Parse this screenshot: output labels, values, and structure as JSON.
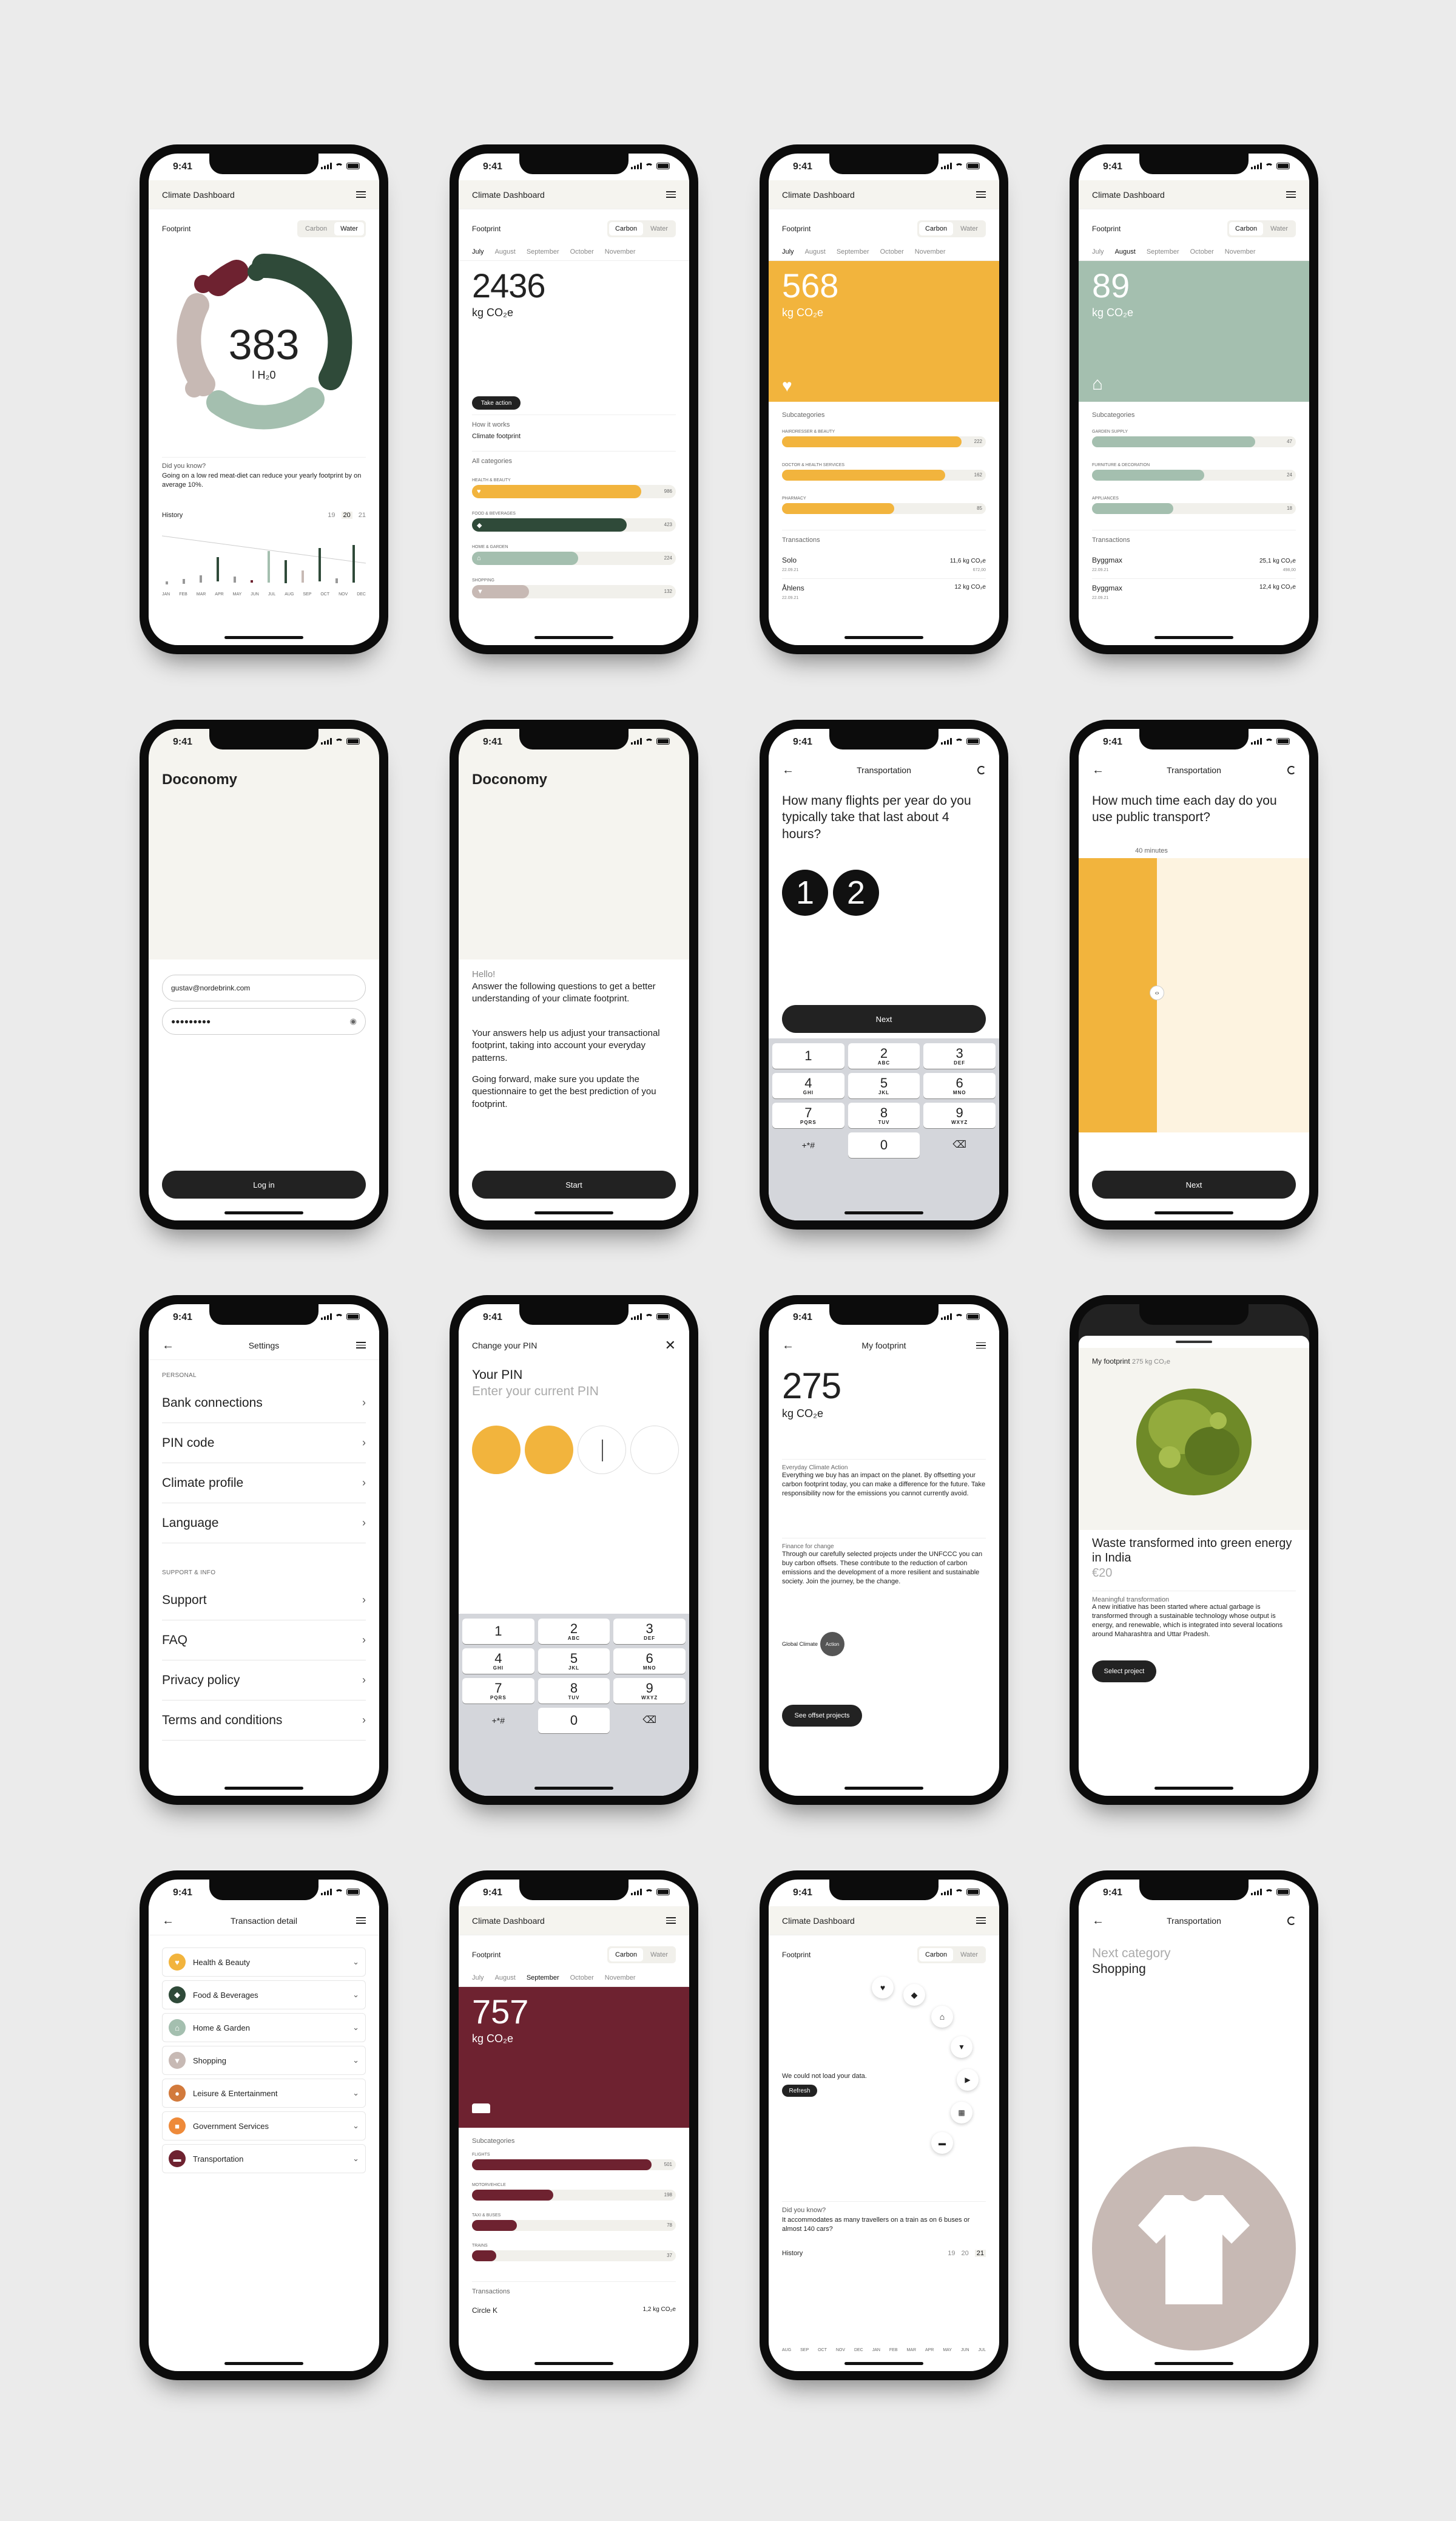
{
  "status_time": "9:41",
  "colors": {
    "green": "#2f4a39",
    "sage": "#a4bfaf",
    "mustard": "#f2b43d",
    "wine": "#6e2230",
    "rose": "#c7b9b4",
    "cream": "#f5f4ef",
    "dark": "#222222"
  },
  "dash": {
    "title": "Climate Dashboard",
    "footprint": "Footprint",
    "carbon": "Carbon",
    "water": "Water"
  },
  "months5": [
    "July",
    "August",
    "September",
    "October",
    "November"
  ],
  "s1": {
    "value": "383",
    "unit": "l H₂0",
    "dyk_title": "Did you know?",
    "dyk_text": "Going on a low red meat-diet can reduce your yearly footprint by on average 10%.",
    "history": "History",
    "years": [
      "19",
      "20",
      "21"
    ],
    "hist_months": [
      "JAN",
      "FEB",
      "MAR",
      "APR",
      "MAY",
      "JUN",
      "JUL",
      "AUG",
      "SEP",
      "OCT",
      "NOV",
      "DEC"
    ]
  },
  "s2": {
    "value": "2436",
    "unit": "kg CO₂e",
    "take_action": "Take action",
    "how": "How it works",
    "how_sub": "Climate footprint",
    "all": "All categories",
    "cats": [
      {
        "label": "HEALTH & BEAUTY",
        "value": "986",
        "pct": 0.83
      },
      {
        "label": "FOOD & BEVERAGES",
        "value": "423",
        "pct": 0.76
      },
      {
        "label": "HOME & GARDEN",
        "value": "224",
        "pct": 0.52
      },
      {
        "label": "SHOPPING",
        "value": "132",
        "pct": 0.28
      }
    ]
  },
  "s3": {
    "value": "568",
    "unit": "kg CO₂e",
    "subcats": "Subcategories",
    "items": [
      {
        "label": "HAIRDRESSER & BEAUTY",
        "value": "222",
        "pct": 0.88
      },
      {
        "label": "DOCTOR & HEALTH SERVICES",
        "value": "162",
        "pct": 0.8
      },
      {
        "label": "PHARMACY",
        "value": "85",
        "pct": 0.55
      }
    ],
    "transactions": "Transactions",
    "tx": [
      {
        "name": "Solo",
        "date": "22.09.21",
        "amount": "11,6 kg CO₂e",
        "price": "672,00"
      },
      {
        "name": "Åhlens",
        "date": "22.09.21",
        "amount": "12 kg CO₂e",
        "price": ""
      }
    ]
  },
  "s4": {
    "value": "89",
    "unit": "kg CO₂e",
    "subcats": "Subcategories",
    "items": [
      {
        "label": "GARDEN SUPPLY",
        "value": "47",
        "pct": 0.8
      },
      {
        "label": "FURNITURE & DECORATION",
        "value": "24",
        "pct": 0.55
      },
      {
        "label": "APPLIANCES",
        "value": "18",
        "pct": 0.4
      }
    ],
    "transactions": "Transactions",
    "tx": [
      {
        "name": "Byggmax",
        "date": "22.09.21",
        "amount": "25,1 kg CO₂e",
        "price": "498,00"
      },
      {
        "name": "Byggmax",
        "date": "22.09.21",
        "amount": "12,4 kg CO₂e",
        "price": ""
      }
    ]
  },
  "login": {
    "brand": "Doconomy",
    "email": "gustav@nordebrink.com",
    "password": "●●●●●●●●●",
    "button": "Log in"
  },
  "intro": {
    "brand": "Doconomy",
    "hello": "Hello!",
    "p1": "Answer the following questions to get a better understanding of your climate footprint.",
    "p2": "Your answers help us adjust your transactional footprint, taking into account your everyday patterns.",
    "p3": "Going forward, make sure you update the questionnaire to get the best prediction of you footprint.",
    "button": "Start"
  },
  "flights": {
    "title": "Transportation",
    "question": "How many flights per year do you typically take that last about 4 hours?",
    "digits": [
      "1",
      "2"
    ],
    "next": "Next"
  },
  "keypad": [
    [
      "1",
      ""
    ],
    [
      "2",
      "ABC"
    ],
    [
      "3",
      "DEF"
    ],
    [
      "4",
      "GHI"
    ],
    [
      "5",
      "JKL"
    ],
    [
      "6",
      "MNO"
    ],
    [
      "7",
      "PQRS"
    ],
    [
      "8",
      "TUV"
    ],
    [
      "9",
      "WXYZ"
    ],
    [
      "+*#",
      ""
    ],
    [
      "0",
      ""
    ],
    [
      "⌫",
      ""
    ]
  ],
  "transit": {
    "title": "Transportation",
    "question": "How much time each day do you use public transport?",
    "minutes": "40 minutes",
    "fraction": 0.34,
    "next": "Next"
  },
  "settings": {
    "title": "Settings",
    "personal": "PERSONAL",
    "items1": [
      "Bank connections",
      "PIN code",
      "Climate profile",
      "Language"
    ],
    "support": "SUPPORT & INFO",
    "items2": [
      "Support",
      "FAQ",
      "Privacy policy",
      "Terms and conditions"
    ]
  },
  "pin": {
    "title": "Change your PIN",
    "heading": "Your PIN",
    "sub": "Enter your current PIN"
  },
  "myfp": {
    "title": "My footprint",
    "value": "275",
    "unit": "kg CO₂e",
    "h1": "Everyday Climate Action",
    "p1": "Everything we buy has an impact on the planet. By offsetting your carbon footprint today, you can make a difference for the future. Take responsibility now for the emissions you cannot currently avoid.",
    "h2": "Finance for change",
    "p2": "Through our carefully selected projects under the UNFCCC you can buy carbon offsets. These contribute to the reduction of carbon emissions and the development of a more resilient and sustainable society. Join the journey, be the change.",
    "logo": "Global Climate",
    "logo2": "Action",
    "button": "See offset projects"
  },
  "project": {
    "label": "My footprint",
    "value": "275 kg CO₂e",
    "title": "Waste transformed into green energy in India",
    "price": "€20",
    "sub": "Meaningful transformation",
    "text": "A new initiative has been started where actual garbage is transformed through a sustainable technology whose output is energy, and renewable, which is integrated into several locations around Maharashtra and Uttar Pradesh.",
    "button": "Select project"
  },
  "txdetail": {
    "title": "Transaction detail",
    "cats": [
      "Health & Beauty",
      "Food & Beverages",
      "Home & Garden",
      "Shopping",
      "Leisure & Entertainment",
      "Government Services",
      "Transportation"
    ]
  },
  "s14": {
    "value": "757",
    "unit": "kg CO₂e",
    "subcats": "Subcategories",
    "items": [
      {
        "label": "FLIGHTS",
        "value": "501",
        "pct": 0.88
      },
      {
        "label": "MOTORVEHICLE",
        "value": "198",
        "pct": 0.4
      },
      {
        "label": "TAXI & BUSES",
        "value": "78",
        "pct": 0.22
      },
      {
        "label": "TRAINS",
        "value": "37",
        "pct": 0.12
      }
    ],
    "transactions": "Transactions",
    "tx": [
      {
        "name": "Circle K",
        "amount": "1,2 kg CO₂e"
      }
    ]
  },
  "s15": {
    "error": "We could not load your data.",
    "refresh": "Refresh",
    "dyk_title": "Did you know?",
    "dyk_text": "It accommodates as many travellers on a train as on 6 buses or almost 140 cars?",
    "history": "History",
    "years": [
      "19",
      "20",
      "21"
    ],
    "hist_months": [
      "AUG",
      "SEP",
      "OCT",
      "NOV",
      "DEC",
      "JAN",
      "FEB",
      "MAR",
      "APR",
      "MAY",
      "JUN",
      "JUL"
    ]
  },
  "nextcat": {
    "title": "Transportation",
    "label": "Next category",
    "category": "Shopping"
  }
}
